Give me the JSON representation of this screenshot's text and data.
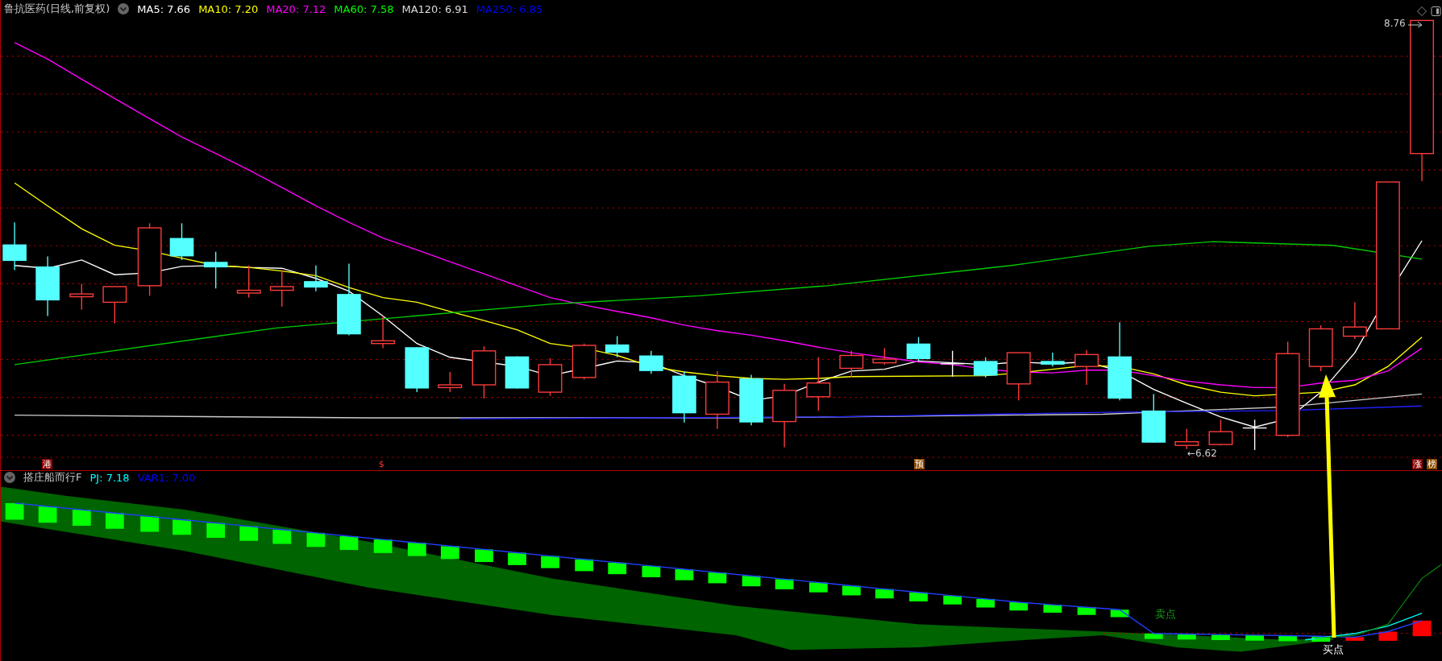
{
  "price_panel": {
    "title": "鲁抗医药(日线,前复权)",
    "indicators": [
      {
        "label": "MA5: 7.66",
        "color": "#ffffff"
      },
      {
        "label": "MA10: 7.20",
        "color": "#ffff00"
      },
      {
        "label": "MA20: 7.12",
        "color": "#ff00ff"
      },
      {
        "label": "MA60: 7.58",
        "color": "#00ff00"
      },
      {
        "label": "MA120: 6.91",
        "color": "#dddddd"
      },
      {
        "label": "MA250: 6.85",
        "color": "#0000ff"
      }
    ],
    "high_label": "8.76",
    "low_label": "←6.62",
    "markers": [
      {
        "text": "港",
        "color": "#8b0000"
      },
      {
        "text": "$",
        "color": "#000000"
      },
      {
        "text": "预",
        "color": "#8b4a00"
      },
      {
        "text": "涨",
        "color": "#8b0000"
      },
      {
        "text": "榜",
        "color": "#8b4a00"
      }
    ]
  },
  "indicator_panel": {
    "title": "搭庄船而行F",
    "indicators": [
      {
        "label": "PJ: 7.18",
        "color": "#00ffff"
      },
      {
        "label": "VAR1: 7.00",
        "color": "#0000ff"
      }
    ],
    "signals": [
      {
        "text": "卖点",
        "kind": "sell"
      },
      {
        "text": "买点",
        "kind": "buy"
      }
    ]
  }
}
